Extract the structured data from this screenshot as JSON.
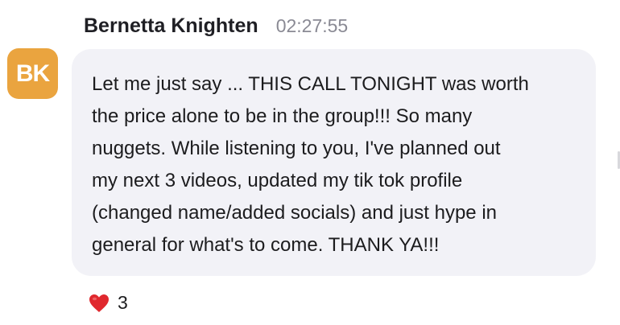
{
  "message": {
    "avatar_initials": "BK",
    "author": "Bernetta Knighten",
    "timestamp": "02:27:55",
    "text": "Let me just say ... THIS CALL TONIGHT was worth\nthe price alone to be in the group!!! So many\nnuggets. While listening to you, I've planned out\nmy next 3 videos, updated my tik tok profile\n(changed name/added socials) and just hype in\ngeneral for what's to come. THANK YA!!!",
    "reaction": {
      "icon": "red-heart-icon",
      "count": "3"
    }
  },
  "colors": {
    "avatar_bg": "#eaa43f",
    "bubble_bg": "#f2f2f7",
    "timestamp": "#8a8a94",
    "heart": "#e0282e"
  }
}
